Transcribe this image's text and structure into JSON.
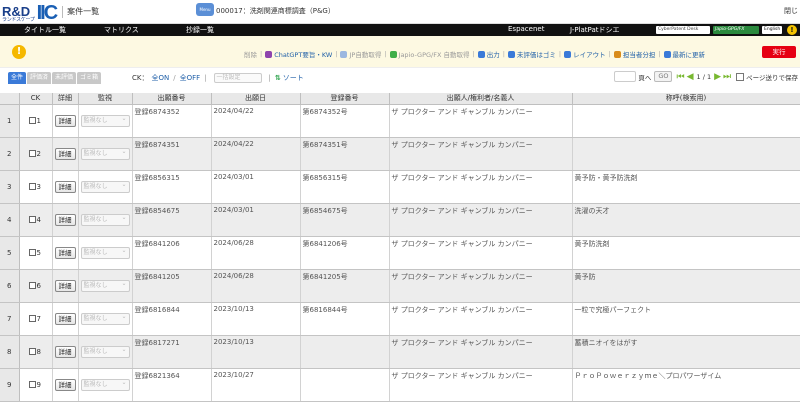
{
  "header": {
    "logo_rd": "R&D",
    "logo_rd_sub": "ランドスケープ",
    "logo_iic": "IIC",
    "page_title": "案件一覧",
    "case_icon_text": "Menu",
    "case_text": "000017：洗剤関連商標調査（P&G）",
    "close_label": "閉じ"
  },
  "menubar": {
    "items": [
      "タイトル一覧",
      "マトリクス",
      "抄録一覧",
      "Espacenet",
      "J-PlatPatドシエ"
    ],
    "badges": [
      "CyberPatent Desk",
      "Japio-GPG/FX",
      "English"
    ],
    "info_icon": "!"
  },
  "toolbar": {
    "warn_icon": "!",
    "items": [
      {
        "label": "削除",
        "style": "muted",
        "icon": null
      },
      {
        "label": "ChatGPT要旨・KW",
        "style": "link",
        "icon": "chatgpt-icon",
        "color": "#8e44ad"
      },
      {
        "label": "JP自動取得",
        "style": "muted",
        "icon": "jp-icon",
        "color": "#9bb7e0"
      },
      {
        "label": "Japio-GPG/FX 自動取得",
        "style": "muted",
        "icon": "japio-icon",
        "color": "#3fae49"
      },
      {
        "label": "出力",
        "style": "link",
        "icon": "export-icon",
        "color": "#3a7ad8"
      },
      {
        "label": "未評価はゴミ",
        "style": "link",
        "icon": "trash-icon",
        "color": "#3a7ad8"
      },
      {
        "label": "レイアウト",
        "style": "link",
        "icon": "layout-icon",
        "color": "#3a7ad8"
      },
      {
        "label": "担当者分担",
        "style": "link",
        "icon": "assign-icon",
        "color": "#d98c1a"
      },
      {
        "label": "最新に更新",
        "style": "link",
        "icon": "refresh-icon",
        "color": "#3a7ad8"
      }
    ],
    "exec_label": "実行"
  },
  "filter": {
    "tabs": [
      "全件",
      "評価済",
      "未評価",
      "ゴミ箱"
    ],
    "ck_label": "CK：",
    "ck_on": "全ON",
    "ck_off": "全OFF",
    "bulk_select": "一括設定",
    "sort_label": "ソート",
    "page_suffix": "頁へ",
    "go_label": "GO",
    "page_text": "1 / 1",
    "save_page_label": "ページ送りで保存"
  },
  "table": {
    "columns": [
      "CK",
      "詳細",
      "監視",
      "出願番号",
      "出願日",
      "登録番号",
      "出願人/権利者/名義人",
      "称呼(検索用)"
    ],
    "detail_label": "詳細",
    "status_placeholder": "監視なし",
    "rows": [
      {
        "n": "1",
        "app": "登録6874352",
        "date": "2024/04/22",
        "reg": "第6874352号",
        "owner": "ザ プロクター アンド ギャンブル カンパニー",
        "name": ""
      },
      {
        "n": "2",
        "app": "登録6874351",
        "date": "2024/04/22",
        "reg": "第6874351号",
        "owner": "ザ プロクター アンド ギャンブル カンパニー",
        "name": ""
      },
      {
        "n": "3",
        "app": "登録6856315",
        "date": "2024/03/01",
        "reg": "第6856315号",
        "owner": "ザ プロクター アンド ギャンブル カンパニー",
        "name": "黄予防・黄予防洗剤"
      },
      {
        "n": "4",
        "app": "登録6854675",
        "date": "2024/03/01",
        "reg": "第6854675号",
        "owner": "ザ プロクター アンド ギャンブル カンパニー",
        "name": "洗濯の天才"
      },
      {
        "n": "5",
        "app": "登録6841206",
        "date": "2024/06/28",
        "reg": "第6841206号",
        "owner": "ザ プロクター アンド ギャンブル カンパニー",
        "name": "黄予防洗剤"
      },
      {
        "n": "6",
        "app": "登録6841205",
        "date": "2024/06/28",
        "reg": "第6841205号",
        "owner": "ザ プロクター アンド ギャンブル カンパニー",
        "name": "黄予防"
      },
      {
        "n": "7",
        "app": "登録6816844",
        "date": "2023/10/13",
        "reg": "第6816844号",
        "owner": "ザ プロクター アンド ギャンブル カンパニー",
        "name": "一粒で究極パーフェクト"
      },
      {
        "n": "8",
        "app": "登録6817271",
        "date": "2023/10/13",
        "reg": "",
        "owner": "ザ プロクター アンド ギャンブル カンパニー",
        "name": "蓄積ニオイをはがす"
      },
      {
        "n": "9",
        "app": "登録6821364",
        "date": "2023/10/27",
        "reg": "",
        "owner": "ザ プロクター アンド ギャンブル カンパニー",
        "name": "ＰｒｏＰｏｗｅｒｚｙｍｅ＼プロパワーザイム"
      }
    ]
  }
}
